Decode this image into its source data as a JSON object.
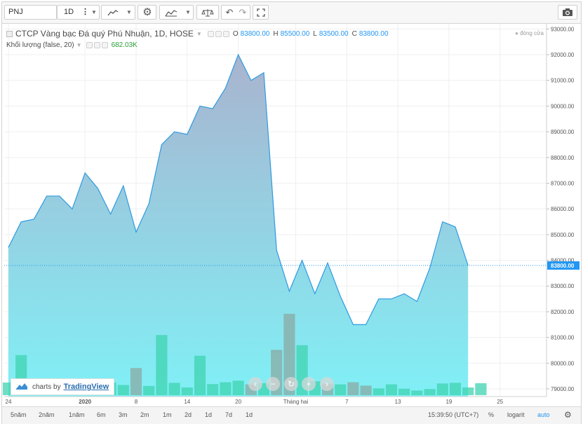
{
  "toolbar": {
    "symbol": "PNJ",
    "interval": "1D"
  },
  "legend": {
    "title": "CTCP Vàng bạc Đá quý Phú Nhuận, 1D, HOSE",
    "ohlc": [
      {
        "key": "O",
        "value": "83800.00"
      },
      {
        "key": "H",
        "value": "85500.00"
      },
      {
        "key": "L",
        "value": "83500.00"
      },
      {
        "key": "C",
        "value": "83800.00"
      }
    ],
    "volume_label": "Khối lượng (false, 20)",
    "volume_value": "682.03K"
  },
  "status": "đóng cửa",
  "branding": {
    "prefix": "charts by",
    "name": "TradingView"
  },
  "bottom": {
    "ranges": [
      "5năm",
      "2năm",
      "1năm",
      "6m",
      "3m",
      "2m",
      "1m",
      "2d",
      "1d",
      "7d",
      "1d"
    ],
    "time": "15:39:50 (UTC+7)",
    "percent": "%",
    "log": "logarit",
    "auto": "auto"
  },
  "colors": {
    "line": "#2e9ae0",
    "area_top": "#a9b3cf",
    "area_bottom": "#80f0f6",
    "volume_up": "#3fd3b0",
    "volume_down": "#8aa9a3",
    "price_tag": "#2196f3"
  },
  "chart_data": {
    "type": "area",
    "ylim": [
      78700,
      93200
    ],
    "yticks": [
      79000,
      80000,
      81000,
      82000,
      83000,
      84000,
      85000,
      86000,
      87000,
      88000,
      89000,
      90000,
      91000,
      92000,
      93000
    ],
    "ytick_labels": [
      "79000.00",
      "80000.00",
      "81000.00",
      "82000.00",
      "83000.00",
      "84000.00",
      "85000.00",
      "86000.00",
      "87000.00",
      "88000.00",
      "89000.00",
      "90000.00",
      "91000.00",
      "92000.00",
      "93000.00"
    ],
    "last_price_label": "83800.00",
    "last_price": 83800,
    "xticks": [
      {
        "label": "24",
        "index": 0
      },
      {
        "label": "2020",
        "index": 6
      },
      {
        "label": "8",
        "index": 10
      },
      {
        "label": "14",
        "index": 14
      },
      {
        "label": "20",
        "index": 18
      },
      {
        "label": "Tháng hai",
        "index": 22.5
      },
      {
        "label": "7",
        "index": 26.5
      },
      {
        "label": "13",
        "index": 30.5
      },
      {
        "label": "19",
        "index": 34.5
      },
      {
        "label": "25",
        "index": 38.5
      }
    ],
    "close": [
      84500,
      85500,
      85600,
      86500,
      86500,
      86000,
      87400,
      86800,
      85800,
      86900,
      85100,
      86200,
      88500,
      89000,
      88900,
      90000,
      89900,
      90700,
      92000,
      91000,
      91300,
      84400,
      82800,
      84000,
      82700,
      83900,
      82600,
      81500,
      81500,
      82500,
      82500,
      82700,
      82400,
      83700,
      85500,
      85300,
      83800
    ],
    "volume": [
      410,
      1300,
      200,
      420,
      130,
      280,
      380,
      390,
      410,
      330,
      880,
      300,
      1950,
      400,
      250,
      1280,
      360,
      420,
      470,
      350,
      390,
      1470,
      2640,
      1620,
      450,
      370,
      350,
      420,
      310,
      220,
      350,
      210,
      150,
      200,
      380,
      400,
      250,
      388
    ],
    "volume_is_up": [
      true,
      true,
      true,
      true,
      true,
      true,
      true,
      true,
      true,
      true,
      false,
      true,
      true,
      true,
      true,
      true,
      true,
      true,
      true,
      false,
      true,
      false,
      false,
      true,
      true,
      false,
      true,
      false,
      false,
      true,
      true,
      true,
      true,
      true,
      true,
      true,
      true,
      true
    ]
  }
}
